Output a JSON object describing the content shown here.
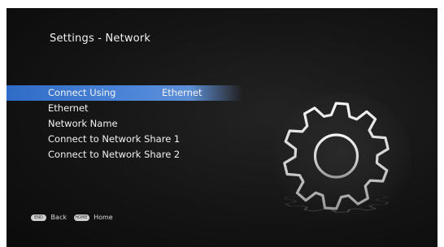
{
  "page_title": "Settings - Network",
  "menu": {
    "items": [
      {
        "label": "Connect Using",
        "value": "Ethernet",
        "selected": true
      },
      {
        "label": "Ethernet"
      },
      {
        "label": "Network Name"
      },
      {
        "label": "Connect to Network Share 1"
      },
      {
        "label": "Connect to Network Share 2"
      }
    ]
  },
  "decoration": {
    "icon": "gear-icon"
  },
  "hints": [
    {
      "key": "END",
      "label": "Back"
    },
    {
      "key": "HOME",
      "label": "Home"
    }
  ],
  "colors": {
    "highlight": "#3a77cf",
    "background": "#141414",
    "text": "#f2f2f2"
  }
}
